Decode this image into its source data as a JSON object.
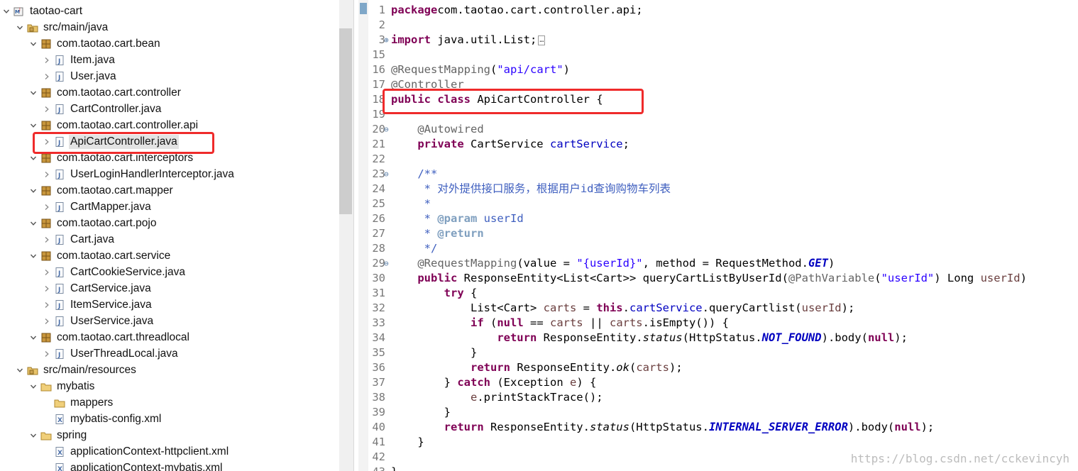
{
  "explorer": {
    "items": [
      {
        "label": "taotao-cart",
        "depth": 0,
        "icon": "project-icon",
        "state": "expanded"
      },
      {
        "label": "src/main/java",
        "depth": 1,
        "icon": "source-folder-icon",
        "state": "expanded"
      },
      {
        "label": "com.taotao.cart.bean",
        "depth": 2,
        "icon": "package-icon",
        "state": "expanded"
      },
      {
        "label": "Item.java",
        "depth": 3,
        "icon": "java-file-icon",
        "state": "collapsed"
      },
      {
        "label": "User.java",
        "depth": 3,
        "icon": "java-file-icon",
        "state": "collapsed"
      },
      {
        "label": "com.taotao.cart.controller",
        "depth": 2,
        "icon": "package-icon",
        "state": "expanded"
      },
      {
        "label": "CartController.java",
        "depth": 3,
        "icon": "java-file-icon",
        "state": "collapsed"
      },
      {
        "label": "com.taotao.cart.controller.api",
        "depth": 2,
        "icon": "package-icon",
        "state": "expanded"
      },
      {
        "label": "ApiCartController.java",
        "depth": 3,
        "icon": "java-file-icon",
        "state": "collapsed",
        "selected": true
      },
      {
        "label": "com.taotao.cart.interceptors",
        "depth": 2,
        "icon": "package-icon",
        "state": "expanded"
      },
      {
        "label": "UserLoginHandlerInterceptor.java",
        "depth": 3,
        "icon": "java-file-icon",
        "state": "collapsed"
      },
      {
        "label": "com.taotao.cart.mapper",
        "depth": 2,
        "icon": "package-icon",
        "state": "expanded"
      },
      {
        "label": "CartMapper.java",
        "depth": 3,
        "icon": "java-file-icon",
        "state": "collapsed"
      },
      {
        "label": "com.taotao.cart.pojo",
        "depth": 2,
        "icon": "package-icon",
        "state": "expanded"
      },
      {
        "label": "Cart.java",
        "depth": 3,
        "icon": "java-file-icon",
        "state": "collapsed"
      },
      {
        "label": "com.taotao.cart.service",
        "depth": 2,
        "icon": "package-icon",
        "state": "expanded"
      },
      {
        "label": "CartCookieService.java",
        "depth": 3,
        "icon": "java-file-icon",
        "state": "collapsed"
      },
      {
        "label": "CartService.java",
        "depth": 3,
        "icon": "java-file-icon",
        "state": "collapsed"
      },
      {
        "label": "ItemService.java",
        "depth": 3,
        "icon": "java-file-icon",
        "state": "collapsed"
      },
      {
        "label": "UserService.java",
        "depth": 3,
        "icon": "java-file-icon",
        "state": "collapsed"
      },
      {
        "label": "com.taotao.cart.threadlocal",
        "depth": 2,
        "icon": "package-icon",
        "state": "expanded"
      },
      {
        "label": "UserThreadLocal.java",
        "depth": 3,
        "icon": "java-file-icon",
        "state": "collapsed"
      },
      {
        "label": "src/main/resources",
        "depth": 1,
        "icon": "source-folder-icon",
        "state": "expanded"
      },
      {
        "label": "mybatis",
        "depth": 2,
        "icon": "folder-icon",
        "state": "expanded"
      },
      {
        "label": "mappers",
        "depth": 3,
        "icon": "folder-icon",
        "state": "none"
      },
      {
        "label": "mybatis-config.xml",
        "depth": 3,
        "icon": "xml-file-icon",
        "state": "none"
      },
      {
        "label": "spring",
        "depth": 2,
        "icon": "folder-icon",
        "state": "expanded"
      },
      {
        "label": "applicationContext-httpclient.xml",
        "depth": 3,
        "icon": "xml-file-icon",
        "state": "none"
      },
      {
        "label": "applicationContext-mybatis.xml",
        "depth": 3,
        "icon": "xml-file-icon",
        "state": "none"
      }
    ]
  },
  "editor": {
    "lines": [
      {
        "num": "1",
        "fold": "",
        "tokens": [
          [
            "kw",
            "package"
          ],
          [
            "",
            "com.taotao.cart.controller.api;"
          ]
        ]
      },
      {
        "num": "2",
        "fold": "",
        "tokens": []
      },
      {
        "num": "3",
        "fold": "+",
        "tokens": [
          [
            "kw",
            "import"
          ],
          [
            "",
            " java.util.List;"
          ],
          [
            "box",
            "…"
          ]
        ]
      },
      {
        "num": "15",
        "fold": "",
        "tokens": []
      },
      {
        "num": "16",
        "fold": "",
        "tokens": [
          [
            "an",
            "@RequestMapping"
          ],
          [
            "",
            "("
          ],
          [
            "str",
            "\"api/cart\""
          ],
          [
            "",
            ")"
          ]
        ]
      },
      {
        "num": "17",
        "fold": "",
        "tokens": [
          [
            "an",
            "@Controller"
          ]
        ]
      },
      {
        "num": "18",
        "fold": "",
        "tokens": [
          [
            "kw",
            "public"
          ],
          [
            "",
            " "
          ],
          [
            "kw",
            "class"
          ],
          [
            "",
            " ApiCartController {"
          ]
        ]
      },
      {
        "num": "19",
        "fold": "",
        "tokens": []
      },
      {
        "num": "20",
        "fold": "-",
        "tokens": [
          [
            "",
            "    "
          ],
          [
            "an",
            "@Autowired"
          ]
        ]
      },
      {
        "num": "21",
        "fold": "",
        "tokens": [
          [
            "",
            "    "
          ],
          [
            "kw",
            "private"
          ],
          [
            "",
            " CartService "
          ],
          [
            "fld",
            "cartService"
          ],
          [
            "",
            ";"
          ]
        ]
      },
      {
        "num": "22",
        "fold": "",
        "tokens": []
      },
      {
        "num": "23",
        "fold": "-",
        "tokens": [
          [
            "",
            "    "
          ],
          [
            "cm",
            "/**"
          ]
        ]
      },
      {
        "num": "24",
        "fold": "",
        "tokens": [
          [
            "cm",
            "     * 对外提供接口服务，根据用户id查询购物车列表"
          ]
        ]
      },
      {
        "num": "25",
        "fold": "",
        "tokens": [
          [
            "cm",
            "     *"
          ]
        ]
      },
      {
        "num": "26",
        "fold": "",
        "tokens": [
          [
            "cm",
            "     * "
          ],
          [
            "tag",
            "@param"
          ],
          [
            "cm",
            " userId"
          ]
        ]
      },
      {
        "num": "27",
        "fold": "",
        "tokens": [
          [
            "cm",
            "     * "
          ],
          [
            "tag",
            "@return"
          ]
        ]
      },
      {
        "num": "28",
        "fold": "",
        "tokens": [
          [
            "cm",
            "     */"
          ]
        ]
      },
      {
        "num": "29",
        "fold": "-",
        "tokens": [
          [
            "",
            "    "
          ],
          [
            "an",
            "@RequestMapping"
          ],
          [
            "",
            "(value = "
          ],
          [
            "str",
            "\"{userId}\""
          ],
          [
            "",
            ", method = RequestMethod."
          ],
          [
            "sfld",
            "GET"
          ],
          [
            "",
            ")"
          ]
        ]
      },
      {
        "num": "30",
        "fold": "",
        "tokens": [
          [
            "",
            "    "
          ],
          [
            "kw",
            "public"
          ],
          [
            "",
            " ResponseEntity<List<Cart>> queryCartListByUserId("
          ],
          [
            "an",
            "@PathVariable"
          ],
          [
            "",
            "("
          ],
          [
            "str",
            "\"userId\""
          ],
          [
            "",
            ") Long "
          ],
          [
            "par",
            "userId"
          ],
          [
            "",
            ")"
          ]
        ]
      },
      {
        "num": "31",
        "fold": "",
        "tokens": [
          [
            "",
            "        "
          ],
          [
            "kw",
            "try"
          ],
          [
            "",
            " {"
          ]
        ]
      },
      {
        "num": "32",
        "fold": "",
        "tokens": [
          [
            "",
            "            List<Cart> "
          ],
          [
            "par",
            "carts"
          ],
          [
            "",
            " = "
          ],
          [
            "kw",
            "this"
          ],
          [
            "",
            "."
          ],
          [
            "fld",
            "cartService"
          ],
          [
            "",
            ".queryCartlist("
          ],
          [
            "par",
            "userId"
          ],
          [
            "",
            ");"
          ]
        ]
      },
      {
        "num": "33",
        "fold": "",
        "tokens": [
          [
            "",
            "            "
          ],
          [
            "kw",
            "if"
          ],
          [
            "",
            " ("
          ],
          [
            "kw",
            "null"
          ],
          [
            "",
            " == "
          ],
          [
            "par",
            "carts"
          ],
          [
            "",
            " || "
          ],
          [
            "par",
            "carts"
          ],
          [
            "",
            ".isEmpty()) {"
          ]
        ]
      },
      {
        "num": "34",
        "fold": "",
        "tokens": [
          [
            "",
            "                "
          ],
          [
            "kw",
            "return"
          ],
          [
            "",
            " ResponseEntity."
          ],
          [
            "st",
            "status"
          ],
          [
            "",
            "(HttpStatus."
          ],
          [
            "sfld",
            "NOT_FOUND"
          ],
          [
            "",
            ").body("
          ],
          [
            "kw",
            "null"
          ],
          [
            "",
            ");"
          ]
        ]
      },
      {
        "num": "35",
        "fold": "",
        "tokens": [
          [
            "",
            "            }"
          ]
        ]
      },
      {
        "num": "36",
        "fold": "",
        "tokens": [
          [
            "",
            "            "
          ],
          [
            "kw",
            "return"
          ],
          [
            "",
            " ResponseEntity."
          ],
          [
            "st",
            "ok"
          ],
          [
            "",
            "("
          ],
          [
            "par",
            "carts"
          ],
          [
            "",
            ");"
          ]
        ]
      },
      {
        "num": "37",
        "fold": "",
        "tokens": [
          [
            "",
            "        } "
          ],
          [
            "kw",
            "catch"
          ],
          [
            "",
            " (Exception "
          ],
          [
            "par",
            "e"
          ],
          [
            "",
            ") {"
          ]
        ]
      },
      {
        "num": "38",
        "fold": "",
        "tokens": [
          [
            "",
            "            "
          ],
          [
            "par",
            "e"
          ],
          [
            "",
            ".printStackTrace();"
          ]
        ]
      },
      {
        "num": "39",
        "fold": "",
        "tokens": [
          [
            "",
            "        }"
          ]
        ]
      },
      {
        "num": "40",
        "fold": "",
        "tokens": [
          [
            "",
            "        "
          ],
          [
            "kw",
            "return"
          ],
          [
            "",
            " ResponseEntity."
          ],
          [
            "st",
            "status"
          ],
          [
            "",
            "(HttpStatus."
          ],
          [
            "sfld",
            "INTERNAL_SERVER_ERROR"
          ],
          [
            "",
            ").body("
          ],
          [
            "kw",
            "null"
          ],
          [
            "",
            ");"
          ]
        ]
      },
      {
        "num": "41",
        "fold": "",
        "tokens": [
          [
            "",
            "    }"
          ]
        ]
      },
      {
        "num": "42",
        "fold": "",
        "tokens": []
      },
      {
        "num": "43",
        "fold": "",
        "tokens": [
          [
            "",
            "}"
          ]
        ]
      }
    ]
  },
  "watermark": "https://blog.csdn.net/cckevincyh",
  "colors": {
    "highlight": "#ef2b2b",
    "keyword": "#7f0055",
    "string": "#2a00ff",
    "comment": "#3f5fbf"
  }
}
